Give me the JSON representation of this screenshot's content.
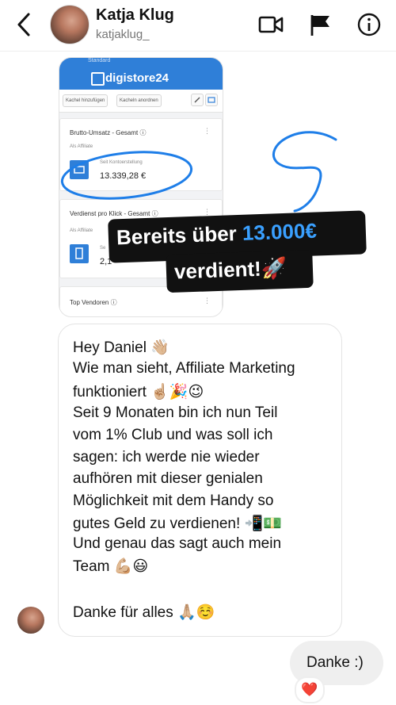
{
  "header": {
    "name": "Katja Klug",
    "handle": "katjaklug_",
    "icons": [
      "chevron-left-icon",
      "video-camera-icon",
      "flag-icon",
      "info-icon"
    ]
  },
  "story_card": {
    "tab_text": "Standard",
    "logo": "digistore24",
    "toolbar_buttons": [
      "Kachel hinzufügen",
      "Kacheln anordnen"
    ],
    "panels": [
      {
        "title": "Brutto-Umsatz - Gesamt ⓘ",
        "subtitle": "Als Affiliate",
        "label": "Seit Kontoerstellung",
        "value": "13.339,28 €"
      },
      {
        "title": "Verdienst pro Klick - Gesamt ⓘ",
        "subtitle": "Als Affiliate",
        "label": "Se",
        "value": "2,1"
      },
      {
        "title": "Top Vendoren ⓘ"
      }
    ]
  },
  "sticker": {
    "line1_prefix": "Bereits über ",
    "line1_highlight": "13.000€",
    "line2": "verdient!🚀",
    "highlight_color": "#3aa0ff"
  },
  "message": {
    "lines": [
      "Hey Daniel 👋🏼",
      "Wie man sieht, Affiliate Marketing",
      "funktioniert ☝🏼🎉😉",
      "Seit 9 Monaten bin ich nun Teil",
      "vom 1% Club und was soll ich",
      "sagen: ich werde nie wieder",
      "aufhören mit dieser genialen",
      "Möglichkeit mit dem Handy so",
      "gutes Geld zu verdienen! 📲💵",
      "Und genau das sagt auch mein",
      "Team 💪🏼😃",
      "",
      "Danke für alles 🙏🏼☺️"
    ]
  },
  "reply": {
    "text": "Danke :)",
    "reaction": "❤️"
  },
  "colors": {
    "accent": "#2f7fd8",
    "underline": "#1e7ee8",
    "bubble_border": "#e3e3e3",
    "reply_bg": "#efefef"
  }
}
